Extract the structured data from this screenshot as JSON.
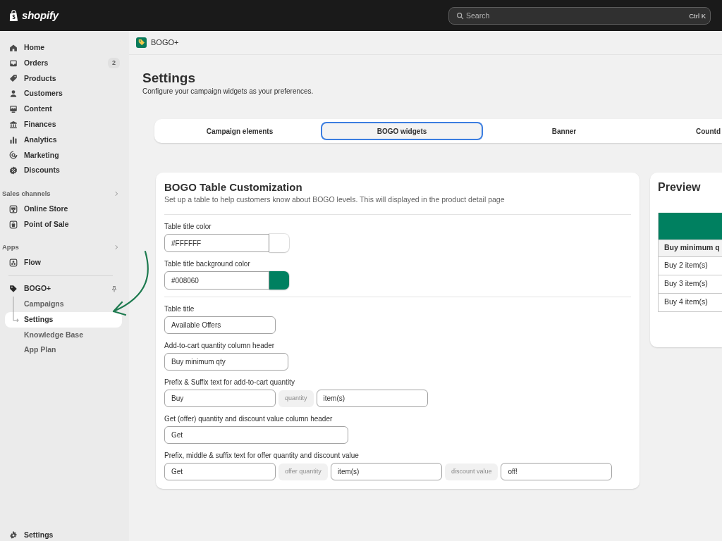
{
  "top_bar": {
    "logo_text": "shopify",
    "search": {
      "placeholder": "Search",
      "shortcut": "Ctrl K"
    }
  },
  "sidebar": {
    "items": [
      {
        "label": "Home",
        "selected": false
      },
      {
        "label": "Orders",
        "badge": "2",
        "selected": false
      },
      {
        "label": "Products",
        "selected": false
      },
      {
        "label": "Customers",
        "selected": false
      },
      {
        "label": "Content",
        "selected": false
      },
      {
        "label": "Finances",
        "selected": false
      },
      {
        "label": "Analytics",
        "selected": false
      },
      {
        "label": "Marketing",
        "selected": false
      },
      {
        "label": "Discounts",
        "selected": false
      }
    ],
    "sections": [
      {
        "title": "Sales channels",
        "items": [
          {
            "label": "Online Store",
            "selected": false
          },
          {
            "label": "Point of Sale",
            "selected": false
          }
        ]
      },
      {
        "title": "Apps",
        "items": [
          {
            "label": "Flow",
            "selected": false
          }
        ]
      }
    ],
    "pinned_app": {
      "label": "BOGO+",
      "children": [
        {
          "label": "Campaigns",
          "selected": false
        },
        {
          "label": "Settings",
          "selected": true
        },
        {
          "label": "Knowledge Base",
          "selected": false
        },
        {
          "label": "App Plan",
          "selected": false
        }
      ]
    },
    "footer_item": {
      "label": "Settings"
    }
  },
  "app_header": {
    "title": "BOGO+"
  },
  "page": {
    "title": "Settings",
    "subtitle": "Configure your campaign widgets as your preferences."
  },
  "tabs": [
    {
      "label": "Campaign elements",
      "selected": false
    },
    {
      "label": "BOGO widgets",
      "selected": true
    },
    {
      "label": "Banner",
      "selected": false
    },
    {
      "label": "Countd",
      "selected": false
    }
  ],
  "customization_card": {
    "title": "BOGO Table Customization",
    "description": "Set up a table to help customers know about BOGO levels. This will displayed in the product detail page",
    "groups": [
      {
        "fields": [
          {
            "kind": "color",
            "label": "Table title color",
            "value": "#FFFFFF"
          },
          {
            "kind": "color",
            "label": "Table title background color",
            "value": "#008060"
          }
        ]
      },
      {
        "fields": [
          {
            "kind": "text",
            "label": "Table title",
            "value": "Available Offers"
          },
          {
            "kind": "text",
            "label": "Add-to-cart quantity column header",
            "value": "Buy minimum qty"
          },
          {
            "kind": "composite",
            "label": "Prefix & Suffix text for add-to-cart quantity",
            "parts": [
              {
                "kind": "input",
                "value": "Buy"
              },
              {
                "kind": "token",
                "text": "quantity"
              },
              {
                "kind": "input",
                "value": "item(s)"
              }
            ]
          },
          {
            "kind": "text",
            "label": "Get (offer) quantity and discount value column header",
            "value": "Get"
          },
          {
            "kind": "composite",
            "label": "Prefix, middle & suffix text for offer quantity and discount value",
            "parts": [
              {
                "kind": "input",
                "value": "Get"
              },
              {
                "kind": "token",
                "text": "offer quantity"
              },
              {
                "kind": "input",
                "value": "item(s)"
              },
              {
                "kind": "token",
                "text": "discount value"
              },
              {
                "kind": "input",
                "value": "off!"
              }
            ]
          }
        ]
      }
    ]
  },
  "preview": {
    "title": "Preview",
    "table": {
      "column_header": "Buy minimum q",
      "rows": [
        [
          "Buy 2 item(s)"
        ],
        [
          "Buy 3 item(s)"
        ],
        [
          "Buy 4 item(s)"
        ]
      ]
    }
  }
}
